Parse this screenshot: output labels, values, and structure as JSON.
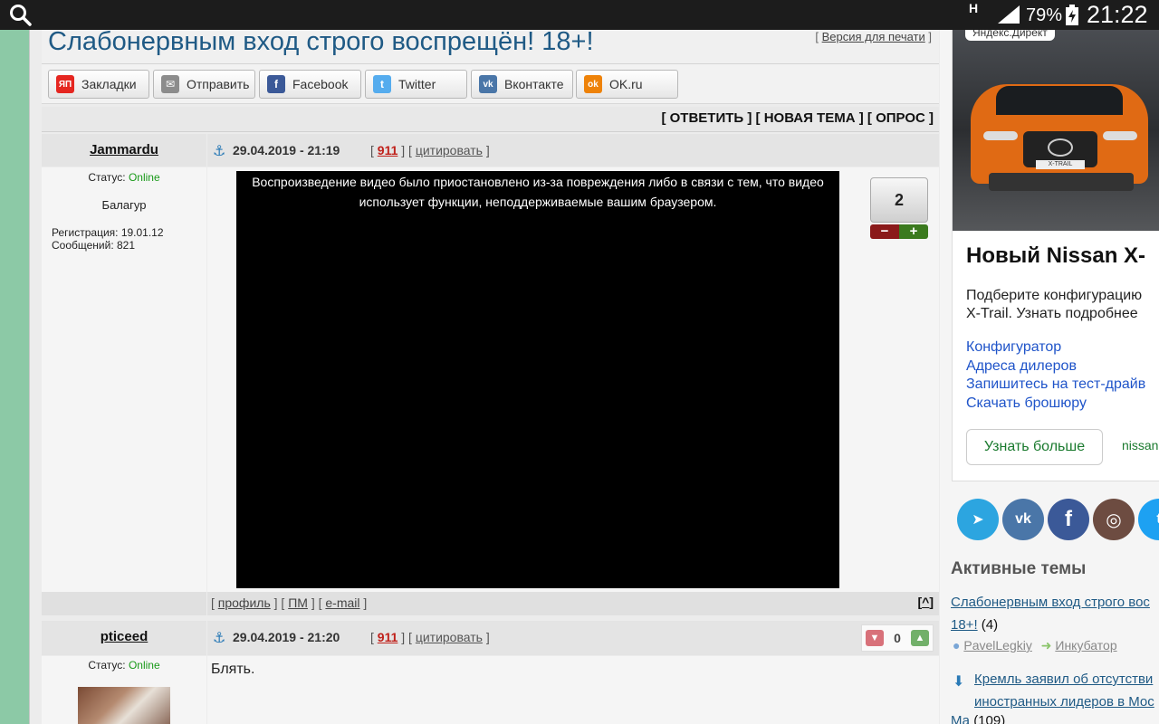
{
  "status_bar": {
    "network": "H",
    "battery": "79%",
    "time": "21:22"
  },
  "topic": {
    "title": "Слабонервным вход строго воспрещён! 18+!",
    "print_version": "Версия для печати"
  },
  "share": [
    {
      "label": "Закладки",
      "icon": "ЯП",
      "color": "#e52620"
    },
    {
      "label": "Отправить",
      "icon": "✉",
      "color": "#8c8c8c"
    },
    {
      "label": "Facebook",
      "icon": "f",
      "color": "#3b5998"
    },
    {
      "label": "Twitter",
      "icon": "t",
      "color": "#55acee"
    },
    {
      "label": "Вконтакте",
      "icon": "vk",
      "color": "#4a76a8"
    },
    {
      "label": "OK.ru",
      "icon": "ok",
      "color": "#ee8208"
    }
  ],
  "actions": {
    "reply": "ОТВЕТИТЬ",
    "new_topic": "НОВАЯ ТЕМА",
    "poll": "ОПРОС"
  },
  "posts": [
    {
      "author": "Jammardu",
      "status_label": "Статус:",
      "status_value": "Online",
      "rank": "Балагур",
      "registration": "Регистрация: 19.01.12",
      "messages": "Сообщений: 821",
      "date": "29.04.2019 - 21:19",
      "post_number": "911",
      "quote": "цитировать",
      "video_message": "Воспроизведение видео было приостановлено из-за повреждения либо в связи с тем, что видео использует функции, неподдерживаемые вашим браузером.",
      "rating": "2",
      "footer": {
        "profile": "профиль",
        "pm": "ПМ",
        "email": "e-mail",
        "top": "^"
      }
    },
    {
      "author": "pticeed",
      "status_label": "Статус:",
      "status_value": "Online",
      "date": "29.04.2019 - 21:20",
      "post_number": "911",
      "quote": "цитировать",
      "text": "Блять.",
      "rating": "0"
    }
  ],
  "ad": {
    "badge": "Яндекс.Директ",
    "plate": "X-TRAIL",
    "title": "Новый Nissan X-",
    "description_line1": "Подберите конфигурацию",
    "description_line2": "X-Trail. Узнать подробнее",
    "links": [
      "Конфигуратор",
      "Адреса дилеров",
      "Запишитесь на тест-драйв",
      "Скачать брошюру"
    ],
    "button": "Узнать больше",
    "domain": "nissan"
  },
  "social": [
    {
      "name": "telegram",
      "color": "#2ca5e0",
      "glyph": "➤"
    },
    {
      "name": "vk",
      "color": "#4a76a8",
      "glyph": "vk"
    },
    {
      "name": "facebook",
      "color": "#3b5998",
      "glyph": "f"
    },
    {
      "name": "instagram",
      "color": "#6d4c41",
      "glyph": "◎"
    },
    {
      "name": "twitter",
      "color": "#1da1f2",
      "glyph": "t"
    }
  ],
  "active_topics": {
    "heading": "Активные темы",
    "topic1_title": "Слабонервным вход строго вос 18+!",
    "topic1_count": "(4)",
    "topic1_user": "PavelLegkiy",
    "topic1_forum": "Инкубатор",
    "topic2_title": "Кремль заявил об отсутстви иностранных лидеров в Мос",
    "topic2_tail": "Ма",
    "topic2_count": "(109)"
  }
}
